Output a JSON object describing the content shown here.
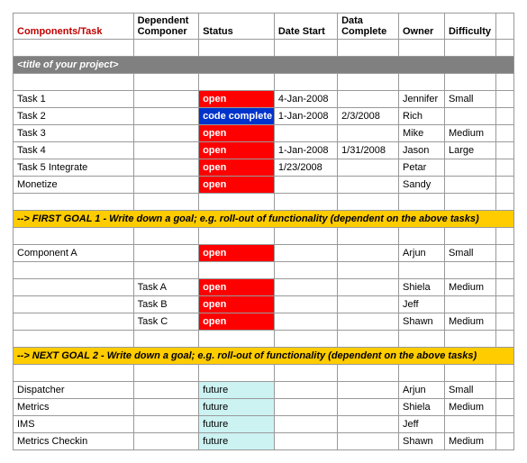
{
  "headers": {
    "components": "Components/Task",
    "dependent": "Dependent Componer",
    "status": "Status",
    "dateStart": "Date Start",
    "dateComplete": "Data Complete",
    "owner": "Owner",
    "difficulty": "Difficulty"
  },
  "projectTitle": "<title of your project>",
  "section1": [
    {
      "task": "Task 1",
      "dep": "",
      "status": "open",
      "statusClass": "open",
      "start": "4-Jan-2008",
      "complete": "",
      "owner": "Jennifer",
      "diff": "Small"
    },
    {
      "task": "Task 2",
      "dep": "",
      "status": "code complete",
      "statusClass": "codecomplete",
      "start": "1-Jan-2008",
      "complete": "2/3/2008",
      "owner": "Rich",
      "diff": ""
    },
    {
      "task": "Task 3",
      "dep": "",
      "status": "open",
      "statusClass": "open",
      "start": "",
      "complete": "",
      "owner": "Mike",
      "diff": "Medium"
    },
    {
      "task": "Task 4",
      "dep": "",
      "status": "open",
      "statusClass": "open",
      "start": "1-Jan-2008",
      "complete": "1/31/2008",
      "owner": "Jason",
      "diff": "Large"
    },
    {
      "task": "Task 5 Integrate",
      "dep": "",
      "status": "open",
      "statusClass": "open",
      "start": "1/23/2008",
      "complete": "",
      "owner": "Petar",
      "diff": ""
    },
    {
      "task": "Monetize",
      "dep": "",
      "status": "open",
      "statusClass": "open",
      "start": "",
      "complete": "",
      "owner": "Sandy",
      "diff": ""
    }
  ],
  "goal1": "--> FIRST GOAL 1 - Write down a goal; e.g. roll-out of functionality (dependent on the above tasks)",
  "section2": [
    {
      "task": "Component A",
      "dep": "",
      "status": "open",
      "statusClass": "open",
      "start": "",
      "complete": "",
      "owner": "Arjun",
      "diff": "Small"
    },
    {
      "task": "",
      "dep": "Task A",
      "status": "open",
      "statusClass": "open",
      "start": "",
      "complete": "",
      "owner": "Shiela",
      "diff": "Medium"
    },
    {
      "task": "",
      "dep": "Task B",
      "status": "open",
      "statusClass": "open",
      "start": "",
      "complete": "",
      "owner": "Jeff",
      "diff": ""
    },
    {
      "task": "",
      "dep": "Task C",
      "status": "open",
      "statusClass": "open",
      "start": "",
      "complete": "",
      "owner": "Shawn",
      "diff": "Medium"
    }
  ],
  "goal2": "--> NEXT GOAL 2 - Write down a goal; e.g. roll-out of functionality (dependent on the above tasks)",
  "section3": [
    {
      "task": "Dispatcher",
      "dep": "",
      "status": "future",
      "statusClass": "future",
      "start": "",
      "complete": "",
      "owner": "Arjun",
      "diff": "Small"
    },
    {
      "task": "Metrics",
      "dep": "",
      "status": "future",
      "statusClass": "future",
      "start": "",
      "complete": "",
      "owner": "Shiela",
      "diff": "Medium"
    },
    {
      "task": "IMS",
      "dep": "",
      "status": "future",
      "statusClass": "future",
      "start": "",
      "complete": "",
      "owner": "Jeff",
      "diff": ""
    },
    {
      "task": "Metrics Checkin",
      "dep": "",
      "status": "future",
      "statusClass": "future",
      "start": "",
      "complete": "",
      "owner": "Shawn",
      "diff": "Medium"
    }
  ]
}
